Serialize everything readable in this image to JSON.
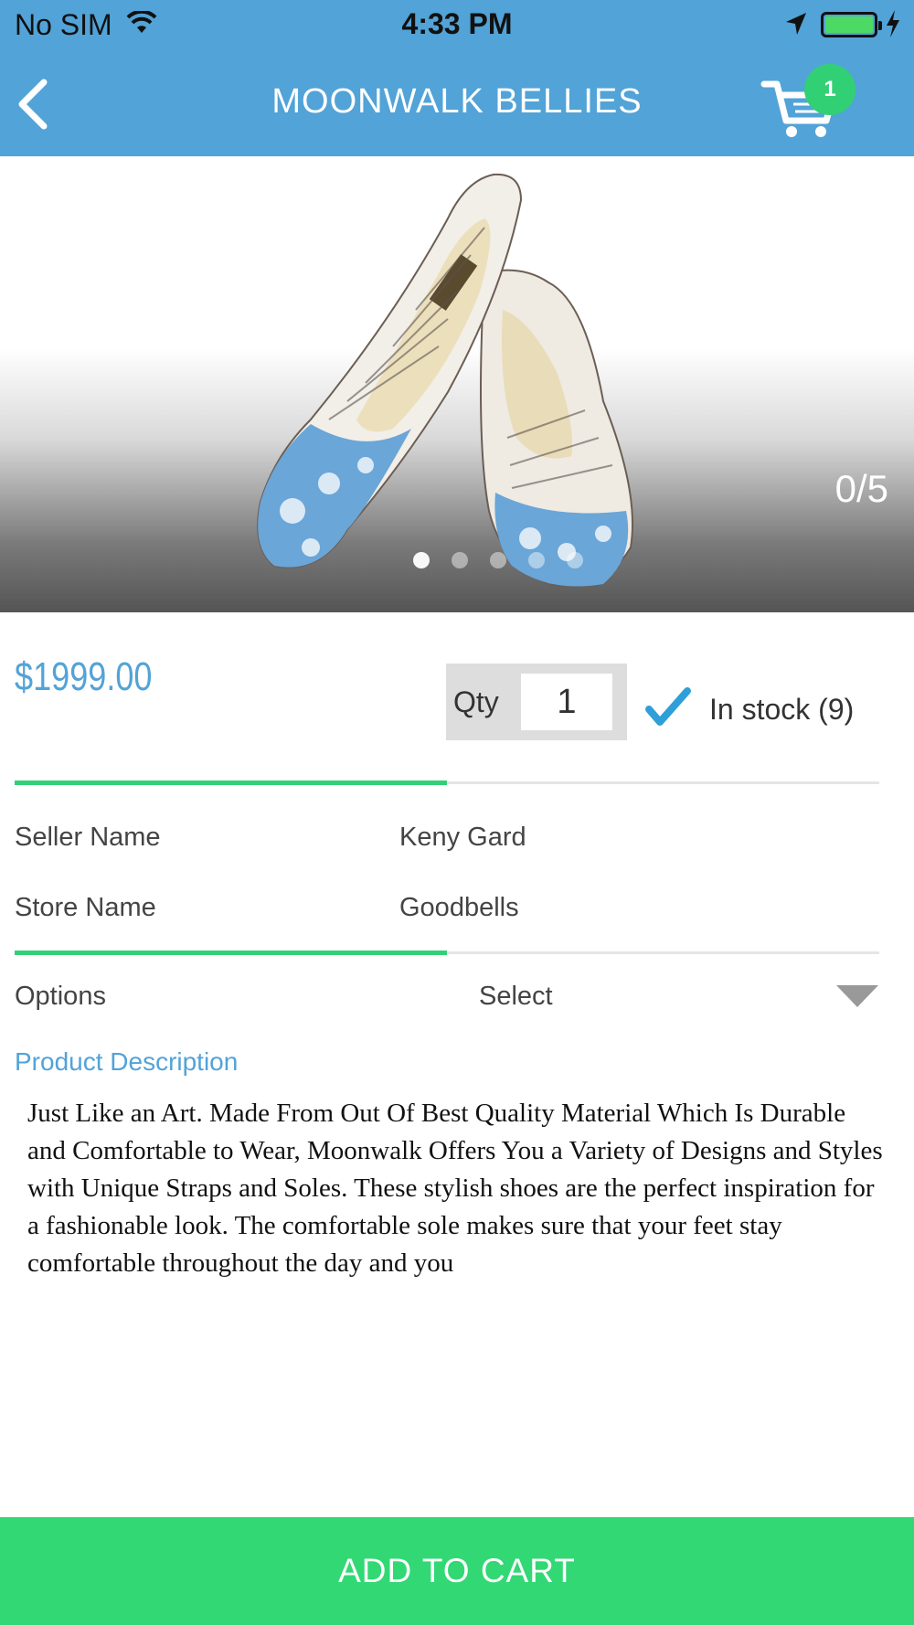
{
  "status_bar": {
    "carrier": "No SIM",
    "time": "4:33 PM"
  },
  "header": {
    "title": "MOONWALK BELLIES",
    "cart_count": "1"
  },
  "gallery": {
    "counter": "0/5",
    "dots": 5,
    "active_dot": 0
  },
  "product": {
    "price": "$1999.00",
    "qty_label": "Qty",
    "qty_value": "1",
    "stock_text": "In stock (9)"
  },
  "seller": {
    "seller_label": "Seller Name",
    "seller_value": "Keny Gard",
    "store_label": "Store Name",
    "store_value": "Goodbells"
  },
  "options": {
    "label": "Options",
    "selected": "Select"
  },
  "description": {
    "title": "Product Description",
    "body": "Just Like an Art. Made From Out Of Best Quality Material Which Is Durable and Comfortable to Wear, Moonwalk Offers You a Variety of Designs and Styles with Unique Straps and Soles. These stylish shoes are the perfect inspiration for a fashionable look. The comfortable sole makes sure that your feet stay comfortable throughout the day and you"
  },
  "footer": {
    "add_to_cart_label": "ADD TO CART"
  },
  "colors": {
    "header_blue": "#52a3d7",
    "accent_green": "#32d874",
    "price_blue": "#52a3d7"
  }
}
